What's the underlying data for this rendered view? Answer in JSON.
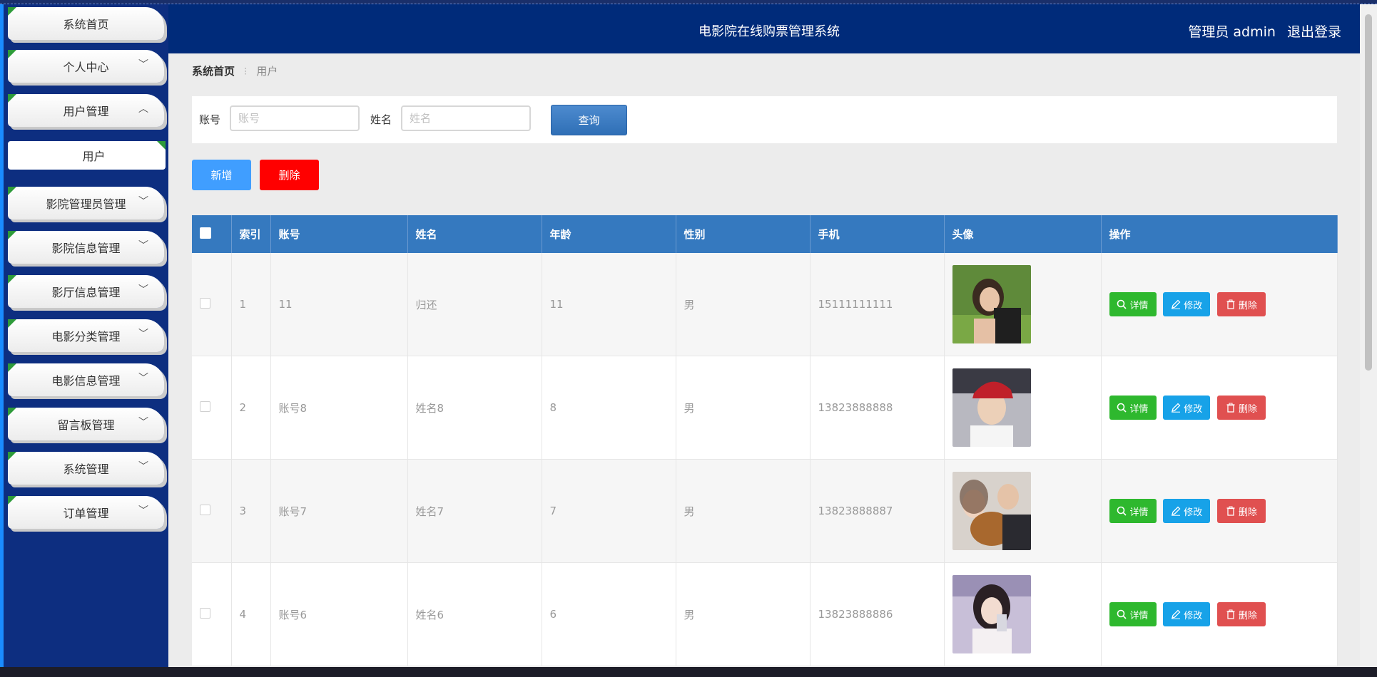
{
  "sidebar": {
    "items": [
      {
        "label": "系统首页",
        "chevron": ""
      },
      {
        "label": "个人中心",
        "chevron": "﹀"
      },
      {
        "label": "用户管理",
        "chevron": "︿"
      },
      {
        "label": "用户",
        "chevron": ""
      },
      {
        "label": "影院管理员管理",
        "chevron": "﹀"
      },
      {
        "label": "影院信息管理",
        "chevron": "﹀"
      },
      {
        "label": "影厅信息管理",
        "chevron": "﹀"
      },
      {
        "label": "电影分类管理",
        "chevron": "﹀"
      },
      {
        "label": "电影信息管理",
        "chevron": "﹀"
      },
      {
        "label": "留言板管理",
        "chevron": "﹀"
      },
      {
        "label": "系统管理",
        "chevron": "﹀"
      },
      {
        "label": "订单管理",
        "chevron": "﹀"
      }
    ]
  },
  "header": {
    "title": "电影院在线购票管理系统",
    "user_label": "管理员 admin",
    "logout_label": "退出登录"
  },
  "breadcrumb": {
    "home": "系统首页",
    "separator": "⁝",
    "current": "用户"
  },
  "search": {
    "account_label": "账号",
    "account_placeholder": "账号",
    "name_label": "姓名",
    "name_placeholder": "姓名",
    "query_label": "查询"
  },
  "actions": {
    "add_label": "新增",
    "delete_label": "删除"
  },
  "table": {
    "headers": [
      "索引",
      "账号",
      "姓名",
      "年龄",
      "性别",
      "手机",
      "头像",
      "操作"
    ],
    "rows": [
      {
        "index": "1",
        "account": "11",
        "name": "归还",
        "age": "11",
        "gender": "男",
        "phone": "15111111111"
      },
      {
        "index": "2",
        "account": "账号8",
        "name": "姓名8",
        "age": "8",
        "gender": "男",
        "phone": "13823888888"
      },
      {
        "index": "3",
        "account": "账号7",
        "name": "姓名7",
        "age": "7",
        "gender": "男",
        "phone": "13823888887"
      },
      {
        "index": "4",
        "account": "账号6",
        "name": "姓名6",
        "age": "6",
        "gender": "男",
        "phone": "13823888886"
      }
    ],
    "op_labels": {
      "detail": "详情",
      "edit": "修改",
      "delete": "删除"
    }
  },
  "colors": {
    "sidebar_bg": "#0d2e80",
    "header_bg": "#002b7a",
    "table_header_bg": "#3579bf",
    "add_button": "#409eff",
    "delete_button": "#ff0000",
    "detail_button": "#2eb82e",
    "edit_button": "#17a2e8",
    "row_delete_button": "#e05050"
  }
}
